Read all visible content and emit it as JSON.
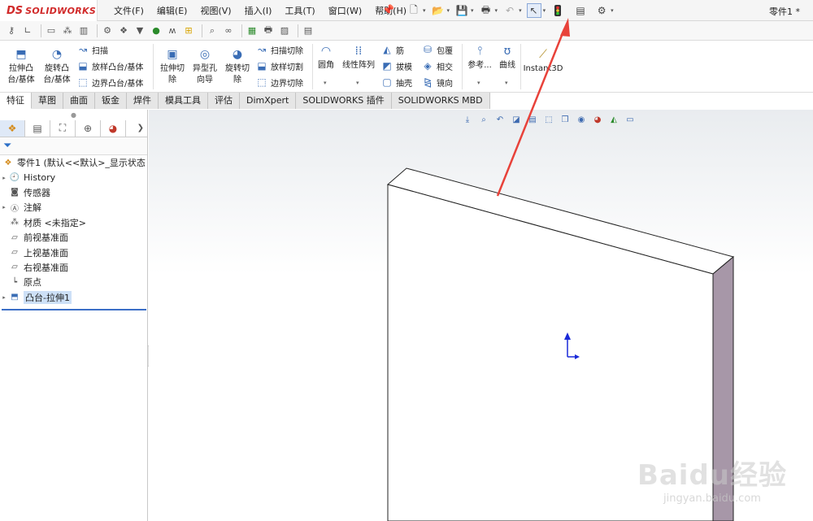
{
  "app": {
    "logo_ds": "DS",
    "logo_text": "SOLIDWORKS",
    "document_title": "零件1 *"
  },
  "menu": [
    "文件(F)",
    "编辑(E)",
    "视图(V)",
    "插入(I)",
    "工具(T)",
    "窗口(W)",
    "帮助(H)"
  ],
  "ribbon": {
    "extrude_boss": [
      "拉伸凸",
      "台/基体"
    ],
    "revolve_boss": [
      "旋转凸",
      "台/基体"
    ],
    "sweep": "扫描",
    "loft": "放样凸台/基体",
    "boundary": "边界凸台/基体",
    "extrude_cut": [
      "拉伸切",
      "除"
    ],
    "hole_wizard": [
      "异型孔",
      "向导"
    ],
    "revolve_cut": [
      "旋转切",
      "除"
    ],
    "swept_cut": "扫描切除",
    "lofted_cut": "放样切割",
    "boundary_cut": "边界切除",
    "fillet": "圆角",
    "linear_pattern": "线性阵列",
    "rib": "筋",
    "draft": "拔模",
    "shell": "抽壳",
    "wrap": "包覆",
    "intersect": "相交",
    "mirror": "镜向",
    "reference": "参考...",
    "curves": "曲线",
    "instant3d": "Instant3D"
  },
  "tabs": [
    "特征",
    "草图",
    "曲面",
    "钣金",
    "焊件",
    "模具工具",
    "评估",
    "DimXpert",
    "SOLIDWORKS 插件",
    "SOLIDWORKS MBD"
  ],
  "tree": {
    "root": "零件1  (默认<<默认>_显示状态",
    "items": [
      {
        "label": "History",
        "expandable": true,
        "icon": "history-icon"
      },
      {
        "label": "传感器",
        "expandable": false,
        "icon": "sensor-icon"
      },
      {
        "label": "注解",
        "expandable": true,
        "icon": "annotation-icon"
      },
      {
        "label": "材质 <未指定>",
        "expandable": false,
        "icon": "material-icon"
      },
      {
        "label": "前视基准面",
        "expandable": false,
        "icon": "plane-icon"
      },
      {
        "label": "上视基准面",
        "expandable": false,
        "icon": "plane-icon"
      },
      {
        "label": "右视基准面",
        "expandable": false,
        "icon": "plane-icon"
      },
      {
        "label": "原点",
        "expandable": false,
        "icon": "origin-icon"
      },
      {
        "label": "凸台-拉伸1",
        "expandable": true,
        "icon": "extrude-feature-icon"
      }
    ]
  },
  "watermark": {
    "main": "Baidu经验",
    "sub": "jingyan.baidu.com"
  },
  "colors": {
    "annotation_arrow": "#e8423a",
    "model_side": "#a797a8",
    "brand_red": "#d12a2a"
  }
}
